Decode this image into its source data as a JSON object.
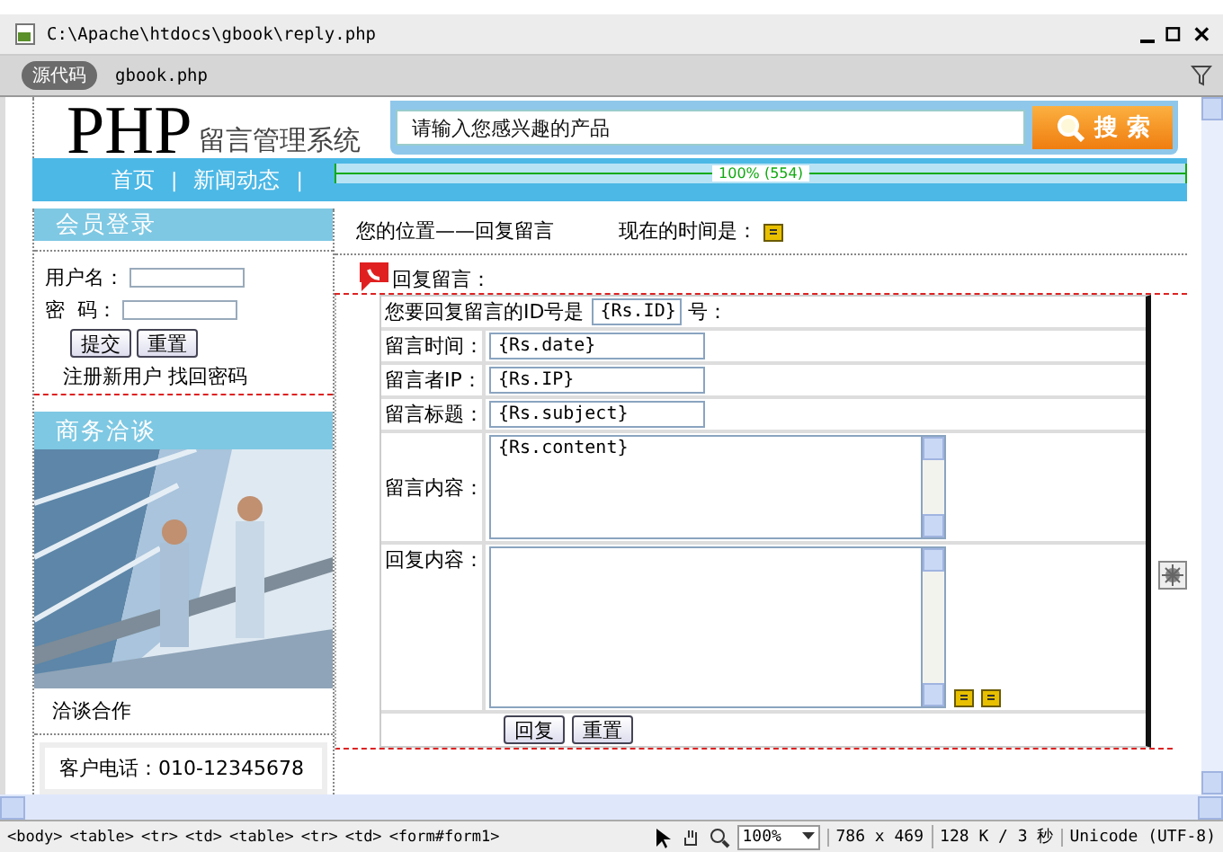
{
  "window": {
    "title": "C:\\Apache\\htdocs\\gbook\\reply.php"
  },
  "toolbar": {
    "source_button": "源代码",
    "related_file": "gbook.php"
  },
  "page": {
    "logo": {
      "big": "PHP",
      "small": "留言管理系统"
    },
    "search": {
      "placeholder": "请输入您感兴趣的产品",
      "button": "搜 索"
    },
    "nav": [
      {
        "label": "首页",
        "separator": "|"
      },
      {
        "label": "新闻动态",
        "separator": "|"
      }
    ],
    "table_width_label": "100% (554)",
    "sidebar": {
      "login_title": "会员登录",
      "username_label": "用户名：",
      "password_label": "密  码：",
      "buttons": [
        "提交",
        "重置"
      ],
      "links": "注册新用户 找回密码",
      "biz_title": "商务洽谈",
      "photo": {
        "kind": "picture"
      },
      "caption": "洽谈合作",
      "contacts": [
        "客户电话：010-12345678"
      ]
    },
    "breadcrumb": "您的位置——回复留言",
    "time_label": "现在的时间是：",
    "form_title": "回复留言：",
    "form": {
      "id_prefix": "您要回复留言的ID号是",
      "id_value": "{Rs.ID}",
      "id_suffix": "号：",
      "rows": [
        {
          "label": "留言时间：",
          "value": "{Rs.date}",
          "kind": "input"
        },
        {
          "label": "留言者IP：",
          "value": "{Rs.IP}",
          "kind": "input"
        },
        {
          "label": "留言标题：",
          "value": "{Rs.subject}",
          "kind": "input"
        },
        {
          "label": "留言内容：",
          "value": "{Rs.content}",
          "kind": "textarea"
        },
        {
          "label": "回复内容：",
          "value": "",
          "kind": "reply"
        }
      ],
      "buttons": [
        "回复",
        "重置"
      ]
    }
  },
  "status_bar": {
    "tags": [
      "<body>",
      "<table>",
      "<tr>",
      "<td>",
      "<table>",
      "<tr>",
      "<td>",
      "<form#form1>"
    ],
    "zoom": "100%",
    "size": "786 x 469",
    "download": "128 K / 3 秒",
    "encoding": "Unicode (UTF-8)"
  }
}
